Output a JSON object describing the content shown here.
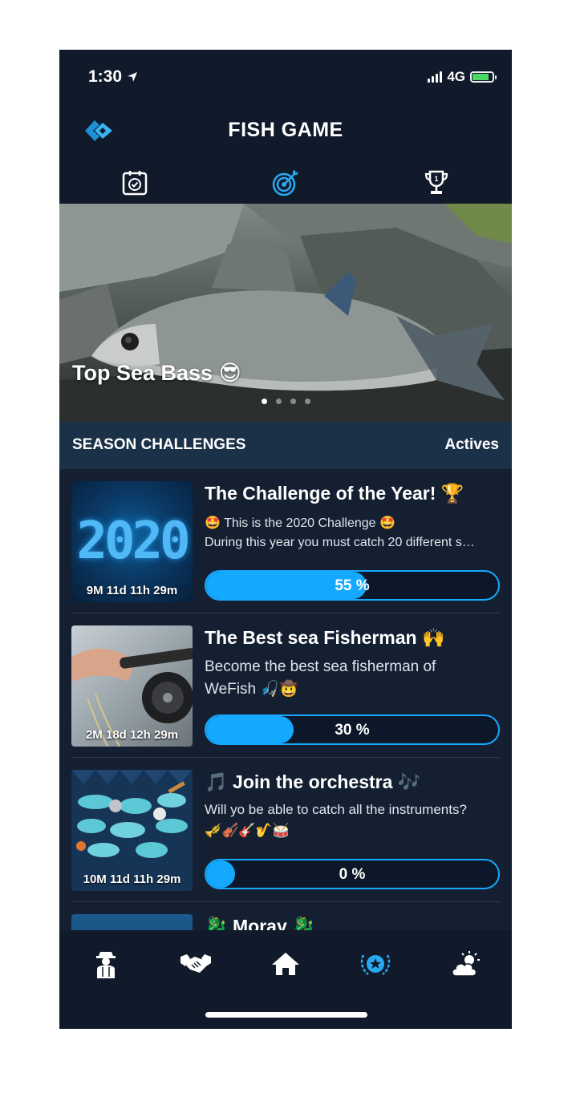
{
  "status_bar": {
    "time": "1:30",
    "network": "4G"
  },
  "header": {
    "title": "FISH GAME"
  },
  "tabs": [
    {
      "name": "tab-daily-checklist",
      "icon": "calendar-check-icon",
      "active": false
    },
    {
      "name": "tab-challenges",
      "icon": "target-icon",
      "active": true
    },
    {
      "name": "tab-rankings",
      "icon": "trophy-icon",
      "active": false
    }
  ],
  "hero": {
    "title": "Top Sea Bass 😎",
    "page_count": 4,
    "active_page": 1
  },
  "section": {
    "title": "SEASON CHALLENGES",
    "link": "Actives"
  },
  "challenges": [
    {
      "title": "The Challenge of the Year! 🏆",
      "desc_line1": "🤩 This is the 2020 Challenge 🤩",
      "desc_line2": "During this year you must catch 20 different s…",
      "timer": "9M 11d 11h 29m",
      "progress": 55,
      "progress_label": "55 %",
      "thumb_text": "2020"
    },
    {
      "title": "The Best sea Fisherman 🙌",
      "desc_line1": "Become the best sea fisherman of",
      "desc_line2": "WeFish 🎣🤠",
      "timer": "2M 18d 12h 29m",
      "progress": 30,
      "progress_label": "30 %"
    },
    {
      "title": "🎵 Join the orchestra 🎶",
      "desc_line1": "Will yo be able to catch all the instruments?",
      "desc_line2": "🎺🎻🎸🎷🥁",
      "timer": "10M 11d 11h 29m",
      "progress": 0,
      "progress_label": "0 %"
    },
    {
      "title": "🐉 Moray 🐉"
    }
  ],
  "bottom_nav": [
    {
      "name": "nav-profile",
      "icon": "fisherman-icon",
      "active": false
    },
    {
      "name": "nav-community",
      "icon": "handshake-icon",
      "active": false
    },
    {
      "name": "nav-home",
      "icon": "home-icon",
      "active": false
    },
    {
      "name": "nav-challenges",
      "icon": "star-badge-icon",
      "active": true
    },
    {
      "name": "nav-weather",
      "icon": "weather-icon",
      "active": false
    }
  ],
  "colors": {
    "accent": "#14a9ff",
    "background": "#142032",
    "bar": "#111a2b",
    "section": "#1a3148"
  }
}
